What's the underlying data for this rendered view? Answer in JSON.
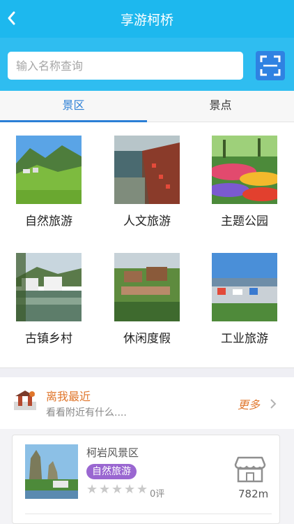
{
  "header": {
    "title": "享游柯桥",
    "back_icon": "back-arrow-icon"
  },
  "search": {
    "placeholder": "输入名称查询",
    "scan_icon": "scan-icon"
  },
  "tabs": [
    {
      "label": "景区",
      "active": true
    },
    {
      "label": "景点",
      "active": false
    }
  ],
  "categories": [
    {
      "label": "自然旅游"
    },
    {
      "label": "人文旅游"
    },
    {
      "label": "主题公园"
    },
    {
      "label": "古镇乡村"
    },
    {
      "label": "休闲度假"
    },
    {
      "label": "工业旅游"
    }
  ],
  "nearby": {
    "title": "离我最近",
    "subtitle": "看看附近有什么....",
    "more_label": "更多",
    "icon": "nearby-map-icon"
  },
  "results": [
    {
      "name": "柯岩风景区",
      "tag": "自然旅游",
      "rating": 0,
      "rating_max": 5,
      "review_label": "0评",
      "distance": "782m",
      "icon": "shop-icon"
    }
  ],
  "colors": {
    "header": "#1db8ee",
    "tab_active": "#2b7fd6",
    "accent_orange": "#e0762b",
    "tag_purple": "#9a67d1",
    "scan_button": "#2f82e2"
  }
}
